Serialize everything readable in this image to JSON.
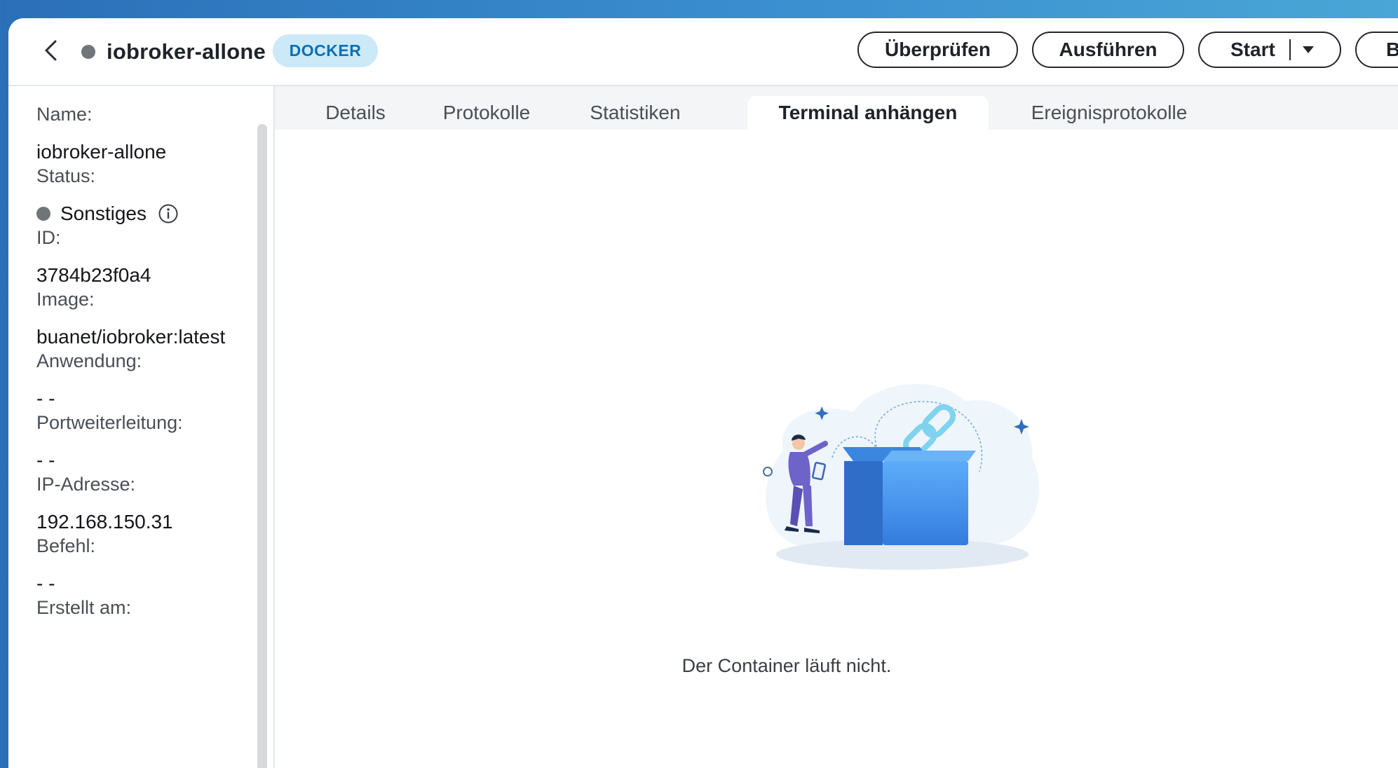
{
  "header": {
    "title": "iobroker-allone",
    "badge": "DOCKER",
    "buttons": {
      "check": "Überprüfen",
      "execute": "Ausführen",
      "start": "Start",
      "more": "B"
    }
  },
  "sidebar": {
    "fields": {
      "name": {
        "label": "Name:",
        "value": "iobroker-allone"
      },
      "status": {
        "label": "Status:",
        "value": "Sonstiges"
      },
      "id": {
        "label": "ID:",
        "value": "3784b23f0a4"
      },
      "image": {
        "label": "Image:",
        "value": "buanet/iobroker:latest"
      },
      "app": {
        "label": "Anwendung:",
        "value": "- -"
      },
      "ports": {
        "label": "Portweiterleitung:",
        "value": "- -"
      },
      "ip": {
        "label": "IP-Adresse:",
        "value": "192.168.150.31"
      },
      "command": {
        "label": "Befehl:",
        "value": "- -"
      },
      "created": {
        "label": "Erstellt am:",
        "value": ""
      }
    }
  },
  "tabs": {
    "details": "Details",
    "logs": "Protokolle",
    "stats": "Statistiken",
    "terminal": "Terminal anhängen",
    "events": "Ereignisprotokolle"
  },
  "main": {
    "empty_message": "Der Container läuft nicht."
  },
  "colors": {
    "status_gray": "#707579",
    "badge_bg": "#cce9f8",
    "badge_text": "#0c6fb4",
    "box_blue": "#3f8fe8"
  }
}
